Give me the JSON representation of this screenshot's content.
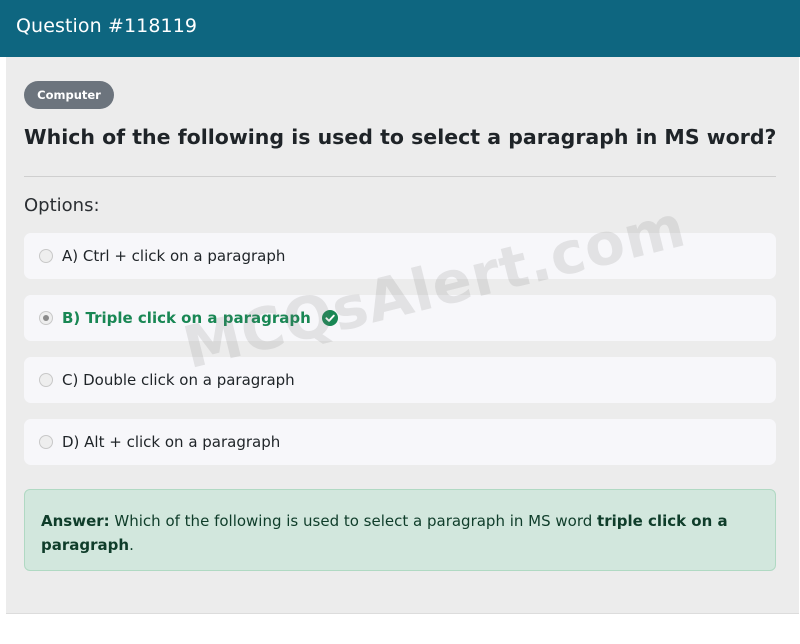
{
  "header": {
    "title": "Question #118119",
    "bg_color": "#0e6680"
  },
  "question": {
    "category_badge": "Computer",
    "text": "Which of the following is used to select a paragraph in MS word?",
    "options_heading": "Options:",
    "options": [
      {
        "label": "A) Ctrl + click on a paragraph",
        "selected": false,
        "correct": false
      },
      {
        "label": "B) Triple click on a paragraph",
        "selected": true,
        "correct": true
      },
      {
        "label": "C) Double click on a paragraph",
        "selected": false,
        "correct": false
      },
      {
        "label": "D) Alt + click on a paragraph",
        "selected": false,
        "correct": false
      }
    ]
  },
  "answer": {
    "prefix": "Answer:",
    "text": " Which of the following is used to select a paragraph in MS word ",
    "highlight": "triple click on a paragraph",
    "suffix": "."
  },
  "watermark": "MCQsAlert.com",
  "colors": {
    "correct": "#198754",
    "answer_bg": "#d2e7dd",
    "badge_bg": "#6c747d"
  }
}
